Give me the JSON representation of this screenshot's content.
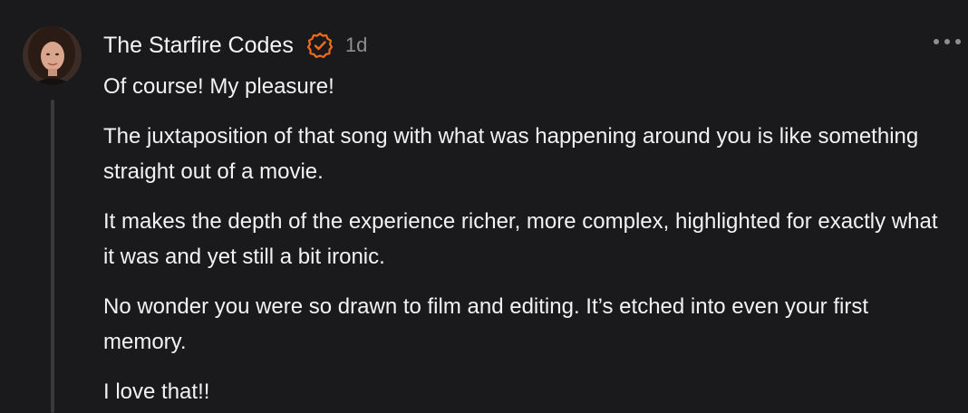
{
  "comment": {
    "author": "The Starfire Codes",
    "timestamp": "1d",
    "badge_icon": "verified-check-icon",
    "more_icon": "ellipsis-icon",
    "accent_color": "#f26a1b",
    "paragraphs": [
      "Of course! My pleasure!",
      "The juxtaposition of that song with what was happening around you is like something straight out of a movie.",
      "It makes the depth of the experience richer, more complex, highlighted for exactly what it was and yet still a bit ironic.",
      "No wonder you were so drawn to film and editing. It’s etched into even your first memory.",
      "I love that!!"
    ]
  }
}
